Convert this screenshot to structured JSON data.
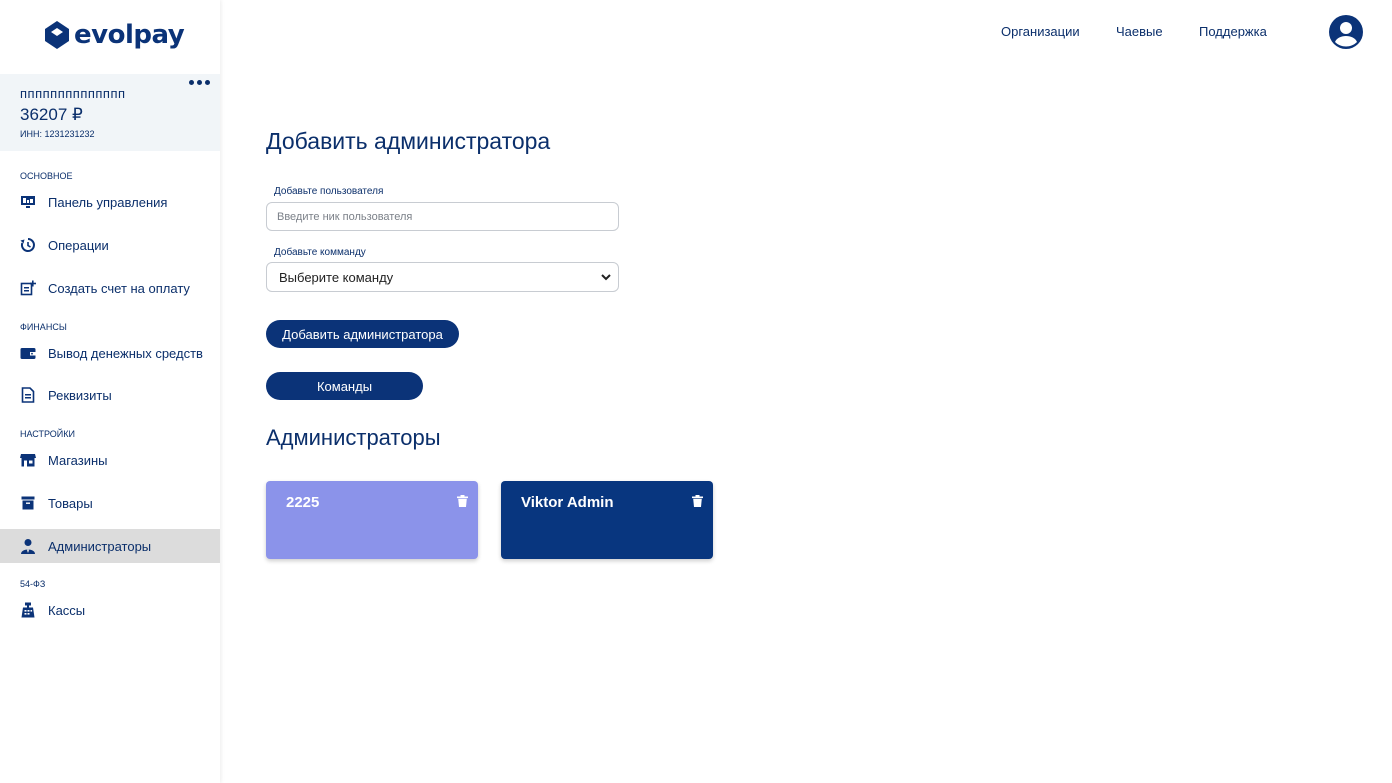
{
  "brand": {
    "logo_text": "evolpay"
  },
  "org": {
    "name": "пппппппппппппп",
    "balance": "36207 ₽",
    "inn": "ИНН: 1231231232"
  },
  "sidebar": {
    "sections": [
      {
        "label": "ОСНОВНОЕ"
      },
      {
        "label": "ФИНАНСЫ"
      },
      {
        "label": "НАСТРОЙКИ"
      },
      {
        "label": "54-ФЗ"
      }
    ],
    "items": [
      {
        "label": "Панель управления",
        "icon": "monitor-icon"
      },
      {
        "label": "Операции",
        "icon": "history-icon"
      },
      {
        "label": "Создать счет на оплату",
        "icon": "invoice-add-icon"
      },
      {
        "label": "Вывод денежных средств",
        "icon": "wallet-icon"
      },
      {
        "label": "Реквизиты",
        "icon": "document-icon"
      },
      {
        "label": "Магазины",
        "icon": "store-icon"
      },
      {
        "label": "Товары",
        "icon": "box-icon"
      },
      {
        "label": "Администраторы",
        "icon": "admin-icon",
        "active": true
      },
      {
        "label": "Кассы",
        "icon": "cash-register-icon"
      }
    ]
  },
  "topnav": {
    "links": [
      "Организации",
      "Чаевые",
      "Поддержка"
    ]
  },
  "main": {
    "title": "Добавить администратора",
    "user_label": "Добавьте пользователя",
    "user_placeholder": "Введите ник пользователя",
    "team_label": "Добавьте комманду",
    "team_selected": "Выберите команду",
    "add_button": "Добавить администратора",
    "teams_button": "Команды",
    "admins_title": "Администраторы",
    "admins": [
      {
        "name": "2225",
        "color": "#8b93ea"
      },
      {
        "name": "Viktor Admin",
        "color": "#08367f"
      }
    ]
  },
  "colors": {
    "primary": "#0b3378",
    "text": "#0b2f6b",
    "active_nav": "#dcdcdc"
  }
}
